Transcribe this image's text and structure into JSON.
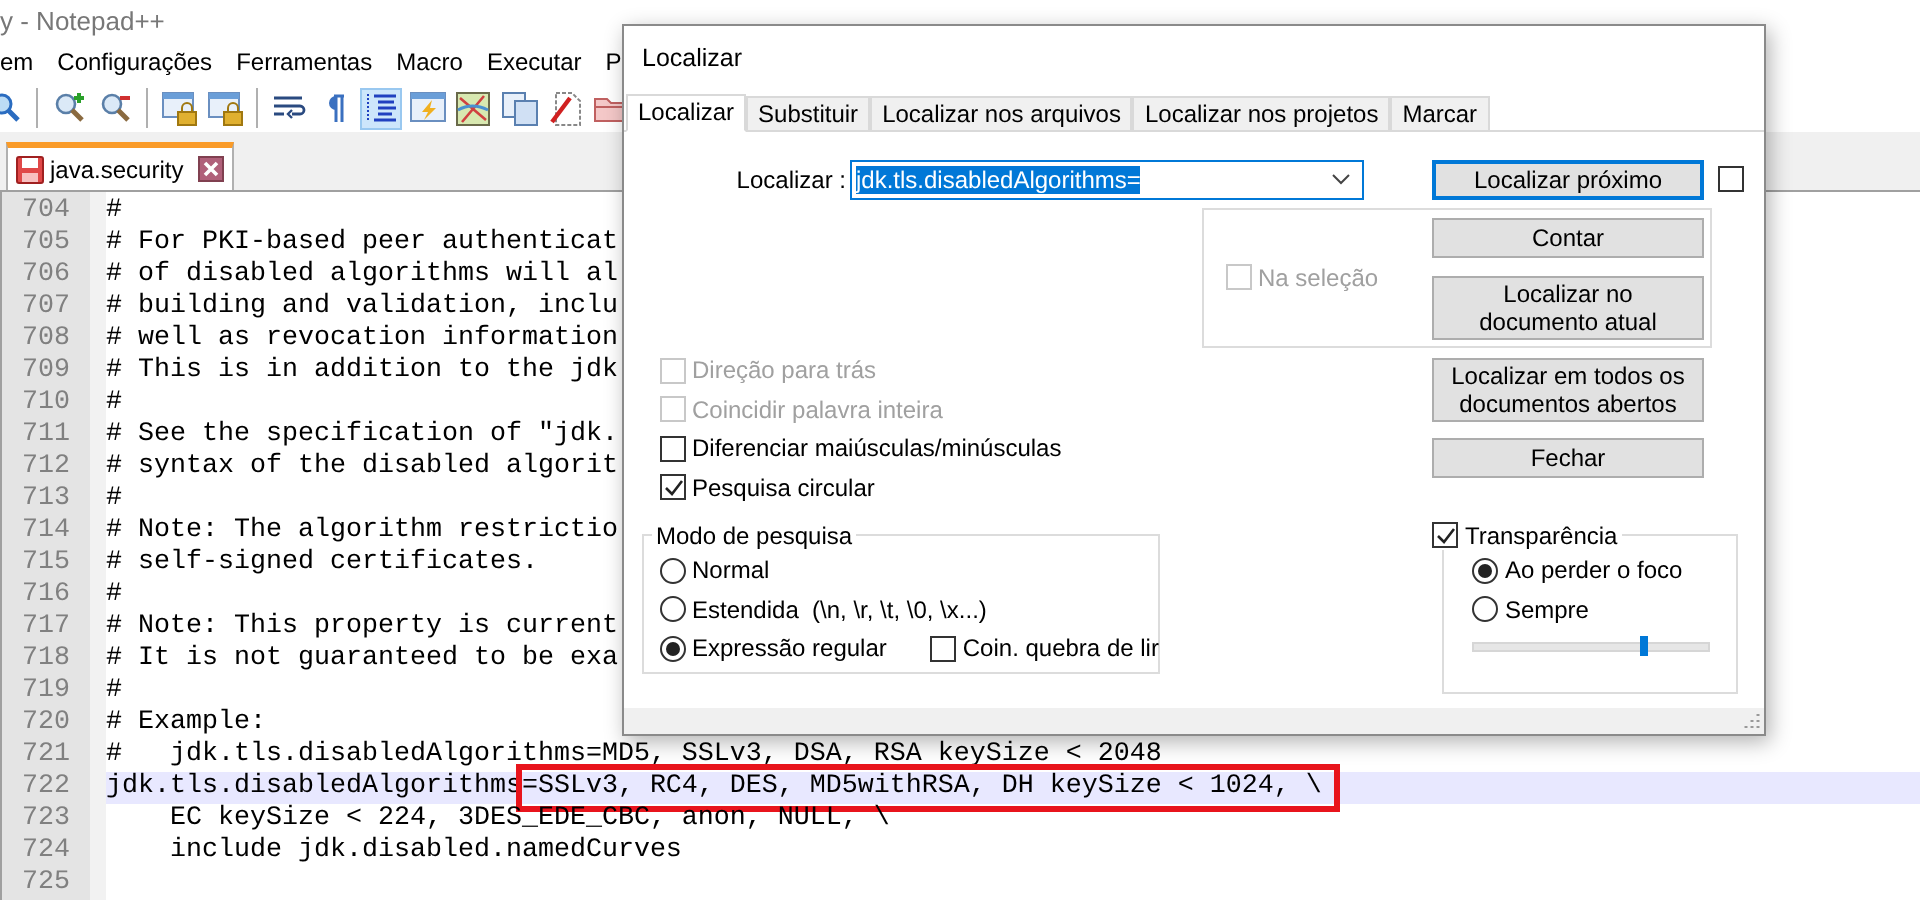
{
  "window": {
    "title": "y - Notepad++"
  },
  "menu": [
    "em",
    "Configurações",
    "Ferramentas",
    "Macro",
    "Executar",
    "P"
  ],
  "toolbar": [
    {
      "kind": "find",
      "pressed": false
    },
    {
      "kind": "separator"
    },
    {
      "kind": "zoom_in",
      "pressed": false
    },
    {
      "kind": "zoom_out",
      "pressed": false
    },
    {
      "kind": "separator"
    },
    {
      "kind": "lock_window",
      "pressed": false
    },
    {
      "kind": "lock_window",
      "pressed": false
    },
    {
      "kind": "separator"
    },
    {
      "kind": "wrap",
      "pressed": false
    },
    {
      "kind": "pilcrow",
      "pressed": false
    },
    {
      "kind": "indent",
      "pressed": true
    },
    {
      "kind": "lightning",
      "pressed": false
    },
    {
      "kind": "map",
      "pressed": false
    },
    {
      "kind": "documents",
      "pressed": false
    },
    {
      "kind": "pen_doc",
      "pressed": false
    },
    {
      "kind": "folder",
      "pressed": false
    }
  ],
  "file_tabs": [
    {
      "label": "java.security",
      "selected": true
    }
  ],
  "editor": {
    "lines": [
      {
        "number": "704",
        "text": "#",
        "current": false
      },
      {
        "number": "705",
        "text": "# For PKI-based peer authenticat",
        "current": false
      },
      {
        "number": "706",
        "text": "# of disabled algorithms will al",
        "current": false
      },
      {
        "number": "707",
        "text": "# building and validation, inclu",
        "current": false
      },
      {
        "number": "708",
        "text": "# well as revocation information",
        "current": false
      },
      {
        "number": "709",
        "text": "# This is in addition to the jdk",
        "current": false
      },
      {
        "number": "710",
        "text": "#",
        "current": false
      },
      {
        "number": "711",
        "text": "# See the specification of \"jdk.",
        "current": false
      },
      {
        "number": "712",
        "text": "# syntax of the disabled algorit",
        "current": false
      },
      {
        "number": "713",
        "text": "#",
        "current": false
      },
      {
        "number": "714",
        "text": "# Note: The algorithm restrictio",
        "current": false
      },
      {
        "number": "715",
        "text": "# self-signed certificates.",
        "current": false
      },
      {
        "number": "716",
        "text": "#",
        "current": false
      },
      {
        "number": "717",
        "text": "# Note: This property is current",
        "current": false
      },
      {
        "number": "718",
        "text": "# It is not guaranteed to be exa",
        "current": false
      },
      {
        "number": "719",
        "text": "#",
        "current": false
      },
      {
        "number": "720",
        "text": "# Example:",
        "current": false
      },
      {
        "number": "721",
        "text": "#   jdk.tls.disabledAlgorithms=MD5, SSLv3, DSA, RSA keySize < 2048",
        "current": false
      },
      {
        "number": "722",
        "text": "jdk.tls.disabledAlgorithms",
        "boxed_text": "=SSLv3, RC4, DES, MD5withRSA, DH keySize < 1024, \\",
        "current": true
      },
      {
        "number": "723",
        "text": "    EC keySize < 224, 3DES_EDE_CBC, anon, NULL, \\",
        "current": false
      },
      {
        "number": "724",
        "text": "    include jdk.disabled.namedCurves",
        "current": false
      },
      {
        "number": "725",
        "current": false
      }
    ]
  },
  "find_dialog": {
    "title": "Localizar",
    "tabs": [
      {
        "label": "Localizar",
        "selected": true
      },
      {
        "label": "Substituir",
        "selected": false
      },
      {
        "label": "Localizar nos arquivos",
        "selected": false
      },
      {
        "label": "Localizar nos projetos",
        "selected": false
      },
      {
        "label": "Marcar",
        "selected": false
      }
    ],
    "search_label": "Localizar :",
    "search_value": "jdk.tls.disabledAlgorithms=",
    "search_value_selected": true,
    "find_next_button": {
      "label": "Localizar próximo",
      "default": true
    },
    "side_checkbox": {
      "checked": false
    },
    "selection_group": {
      "checkbox": {
        "label": "Na seleção",
        "checked": false,
        "disabled": true
      },
      "buttons": [
        {
          "label": "Contar"
        },
        {
          "label": "Localizar no documento atual"
        }
      ]
    },
    "options": [
      {
        "label": "Direção para trás",
        "checked": false,
        "disabled": true
      },
      {
        "label": "Coincidir palavra inteira",
        "checked": false,
        "disabled": true
      },
      {
        "label": "Diferenciar maiúsculas/minúsculas",
        "checked": false,
        "disabled": false
      },
      {
        "label": "Pesquisa circular",
        "checked": true,
        "disabled": false
      }
    ],
    "side_buttons": [
      {
        "label": "Localizar em todos os documentos abertos"
      },
      {
        "label": "Fechar"
      }
    ],
    "search_mode": {
      "title": "Modo de pesquisa",
      "options": [
        {
          "label": "Normal",
          "selected": false
        },
        {
          "label": "Estendida  (\\n, \\r, \\t, \\0, \\x...)",
          "selected": false
        },
        {
          "label": "Expressão regular",
          "selected": true
        }
      ],
      "extra_checkbox": {
        "label": "Coin. quebra de lir",
        "checked": false
      }
    },
    "transparency": {
      "label": "Transparência",
      "checked": true,
      "options": [
        {
          "label": "Ao perder o foco",
          "selected": true
        },
        {
          "label": "Sempre",
          "selected": false
        }
      ],
      "slider": {
        "level": 0.72
      }
    }
  }
}
